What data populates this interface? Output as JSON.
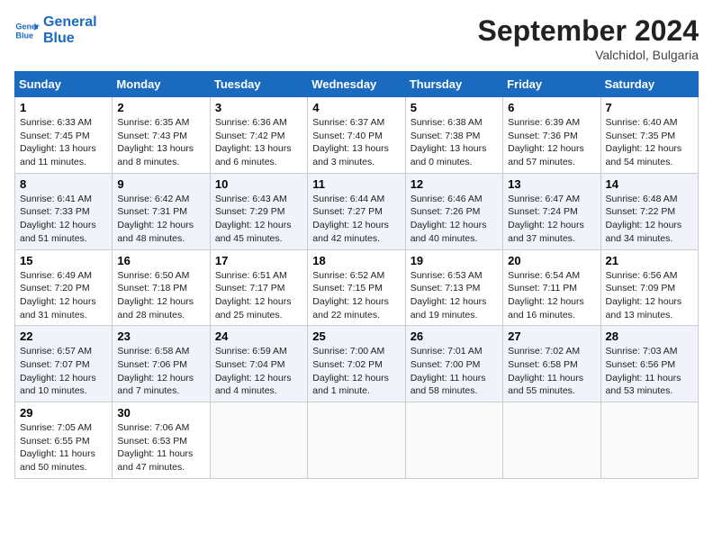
{
  "header": {
    "logo_general": "General",
    "logo_blue": "Blue",
    "month_title": "September 2024",
    "subtitle": "Valchidol, Bulgaria"
  },
  "days_of_week": [
    "Sunday",
    "Monday",
    "Tuesday",
    "Wednesday",
    "Thursday",
    "Friday",
    "Saturday"
  ],
  "weeks": [
    [
      {
        "day": "1",
        "info": "Sunrise: 6:33 AM\nSunset: 7:45 PM\nDaylight: 13 hours\nand 11 minutes."
      },
      {
        "day": "2",
        "info": "Sunrise: 6:35 AM\nSunset: 7:43 PM\nDaylight: 13 hours\nand 8 minutes."
      },
      {
        "day": "3",
        "info": "Sunrise: 6:36 AM\nSunset: 7:42 PM\nDaylight: 13 hours\nand 6 minutes."
      },
      {
        "day": "4",
        "info": "Sunrise: 6:37 AM\nSunset: 7:40 PM\nDaylight: 13 hours\nand 3 minutes."
      },
      {
        "day": "5",
        "info": "Sunrise: 6:38 AM\nSunset: 7:38 PM\nDaylight: 13 hours\nand 0 minutes."
      },
      {
        "day": "6",
        "info": "Sunrise: 6:39 AM\nSunset: 7:36 PM\nDaylight: 12 hours\nand 57 minutes."
      },
      {
        "day": "7",
        "info": "Sunrise: 6:40 AM\nSunset: 7:35 PM\nDaylight: 12 hours\nand 54 minutes."
      }
    ],
    [
      {
        "day": "8",
        "info": "Sunrise: 6:41 AM\nSunset: 7:33 PM\nDaylight: 12 hours\nand 51 minutes."
      },
      {
        "day": "9",
        "info": "Sunrise: 6:42 AM\nSunset: 7:31 PM\nDaylight: 12 hours\nand 48 minutes."
      },
      {
        "day": "10",
        "info": "Sunrise: 6:43 AM\nSunset: 7:29 PM\nDaylight: 12 hours\nand 45 minutes."
      },
      {
        "day": "11",
        "info": "Sunrise: 6:44 AM\nSunset: 7:27 PM\nDaylight: 12 hours\nand 42 minutes."
      },
      {
        "day": "12",
        "info": "Sunrise: 6:46 AM\nSunset: 7:26 PM\nDaylight: 12 hours\nand 40 minutes."
      },
      {
        "day": "13",
        "info": "Sunrise: 6:47 AM\nSunset: 7:24 PM\nDaylight: 12 hours\nand 37 minutes."
      },
      {
        "day": "14",
        "info": "Sunrise: 6:48 AM\nSunset: 7:22 PM\nDaylight: 12 hours\nand 34 minutes."
      }
    ],
    [
      {
        "day": "15",
        "info": "Sunrise: 6:49 AM\nSunset: 7:20 PM\nDaylight: 12 hours\nand 31 minutes."
      },
      {
        "day": "16",
        "info": "Sunrise: 6:50 AM\nSunset: 7:18 PM\nDaylight: 12 hours\nand 28 minutes."
      },
      {
        "day": "17",
        "info": "Sunrise: 6:51 AM\nSunset: 7:17 PM\nDaylight: 12 hours\nand 25 minutes."
      },
      {
        "day": "18",
        "info": "Sunrise: 6:52 AM\nSunset: 7:15 PM\nDaylight: 12 hours\nand 22 minutes."
      },
      {
        "day": "19",
        "info": "Sunrise: 6:53 AM\nSunset: 7:13 PM\nDaylight: 12 hours\nand 19 minutes."
      },
      {
        "day": "20",
        "info": "Sunrise: 6:54 AM\nSunset: 7:11 PM\nDaylight: 12 hours\nand 16 minutes."
      },
      {
        "day": "21",
        "info": "Sunrise: 6:56 AM\nSunset: 7:09 PM\nDaylight: 12 hours\nand 13 minutes."
      }
    ],
    [
      {
        "day": "22",
        "info": "Sunrise: 6:57 AM\nSunset: 7:07 PM\nDaylight: 12 hours\nand 10 minutes."
      },
      {
        "day": "23",
        "info": "Sunrise: 6:58 AM\nSunset: 7:06 PM\nDaylight: 12 hours\nand 7 minutes."
      },
      {
        "day": "24",
        "info": "Sunrise: 6:59 AM\nSunset: 7:04 PM\nDaylight: 12 hours\nand 4 minutes."
      },
      {
        "day": "25",
        "info": "Sunrise: 7:00 AM\nSunset: 7:02 PM\nDaylight: 12 hours\nand 1 minute."
      },
      {
        "day": "26",
        "info": "Sunrise: 7:01 AM\nSunset: 7:00 PM\nDaylight: 11 hours\nand 58 minutes."
      },
      {
        "day": "27",
        "info": "Sunrise: 7:02 AM\nSunset: 6:58 PM\nDaylight: 11 hours\nand 55 minutes."
      },
      {
        "day": "28",
        "info": "Sunrise: 7:03 AM\nSunset: 6:56 PM\nDaylight: 11 hours\nand 53 minutes."
      }
    ],
    [
      {
        "day": "29",
        "info": "Sunrise: 7:05 AM\nSunset: 6:55 PM\nDaylight: 11 hours\nand 50 minutes."
      },
      {
        "day": "30",
        "info": "Sunrise: 7:06 AM\nSunset: 6:53 PM\nDaylight: 11 hours\nand 47 minutes."
      },
      {
        "day": "",
        "info": ""
      },
      {
        "day": "",
        "info": ""
      },
      {
        "day": "",
        "info": ""
      },
      {
        "day": "",
        "info": ""
      },
      {
        "day": "",
        "info": ""
      }
    ]
  ]
}
